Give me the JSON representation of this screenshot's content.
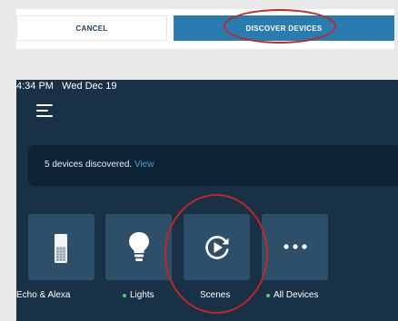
{
  "top_bar": {
    "cancel_label": "CANCEL",
    "discover_label": "DISCOVER DEVICES"
  },
  "device_screen": {
    "status_time": "4:34 PM",
    "status_date": "Wed Dec 19",
    "banner": {
      "message": "5 devices discovered.",
      "link_label": "View"
    },
    "tiles": [
      {
        "label": "Echo & Alexa",
        "icon": "echo-speaker-icon",
        "status_dot": false
      },
      {
        "label": "Lights",
        "icon": "lightbulb-icon",
        "status_dot": true
      },
      {
        "label": "Scenes",
        "icon": "scenes-play-icon",
        "status_dot": false
      },
      {
        "label": "All Devices",
        "icon": "more-dots-icon",
        "status_dot": true
      }
    ]
  },
  "colors": {
    "accent_blue": "#2a7bb0",
    "screen_background": "#183146",
    "tile_background": "#2d4f6a",
    "banner_background": "#0d2234",
    "link_blue": "#3fa8d8",
    "status_green": "#4bd46b",
    "annotation_red": "#c5261f"
  }
}
